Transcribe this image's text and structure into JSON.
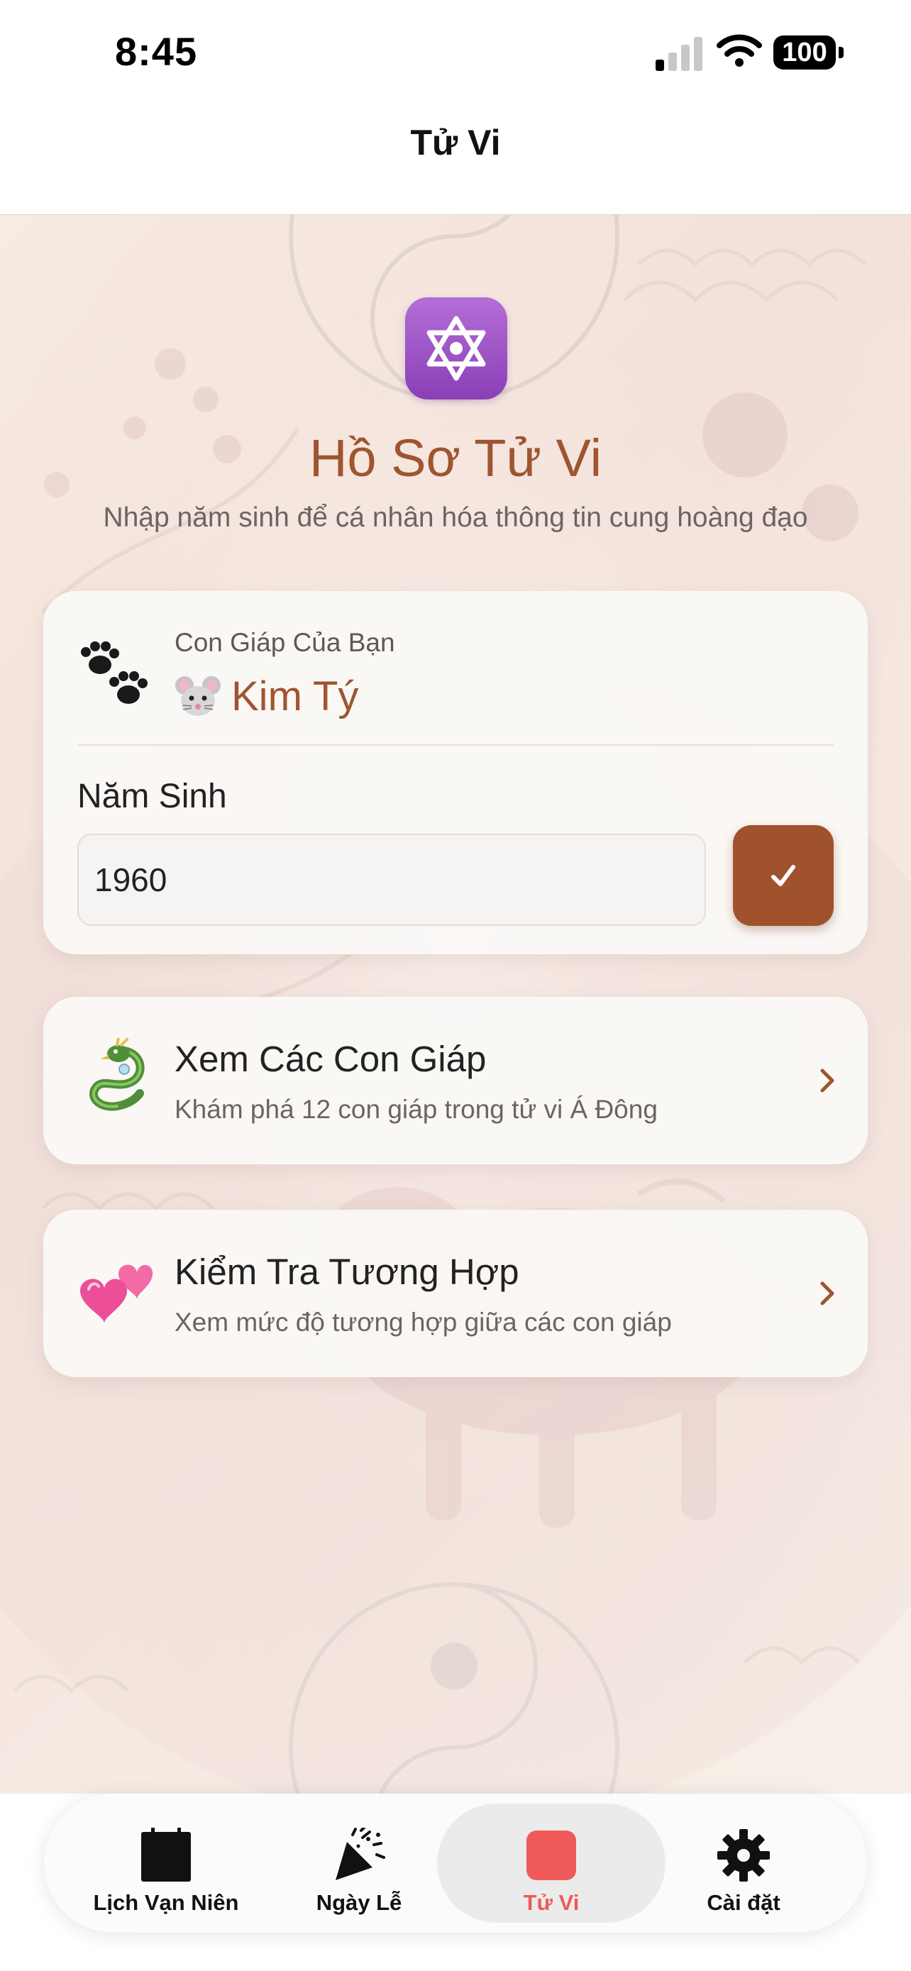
{
  "status_bar": {
    "time": "8:45",
    "battery": "100",
    "icons": [
      "cellular-signal-icon",
      "wifi-icon",
      "battery-icon"
    ]
  },
  "nav": {
    "title": "Tử Vi"
  },
  "header": {
    "icon": "star-of-david-icon",
    "title": "Hồ Sơ Tử Vi",
    "subtitle": "Nhập năm sinh để cá nhân hóa thông tin cung hoàng đạo"
  },
  "zodiac_card": {
    "icon": "paw-prints-icon",
    "label": "Con Giáp Của Bạn",
    "value_icon": "mouse-face-icon",
    "value": "Kim Tý",
    "birth_label": "Năm Sinh",
    "birth_value": "1960",
    "confirm_icon": "checkmark-icon"
  },
  "menu": [
    {
      "icon": "dragon-icon",
      "title": "Xem Các Con Giáp",
      "description": "Khám phá 12 con giáp trong tử vi Á Đông"
    },
    {
      "icon": "two-hearts-icon",
      "title": "Kiểm Tra Tương Hợp",
      "description": "Xem mức độ tương hợp giữa các con giáp"
    }
  ],
  "tabs": [
    {
      "label": "Lịch Vạn Niên",
      "icon": "calendar-icon",
      "selected": false
    },
    {
      "label": "Ngày Lễ",
      "icon": "party-popper-icon",
      "selected": false
    },
    {
      "label": "Tử Vi",
      "icon": "zodiac-square-icon",
      "selected": true
    },
    {
      "label": "Cài đặt",
      "icon": "gear-icon",
      "selected": false
    }
  ],
  "colors": {
    "accent": "#a0522d",
    "title_brown": "#9e5530",
    "selected_tab": "#f05a5a",
    "profile_icon_purple": "#9b4fc5"
  }
}
